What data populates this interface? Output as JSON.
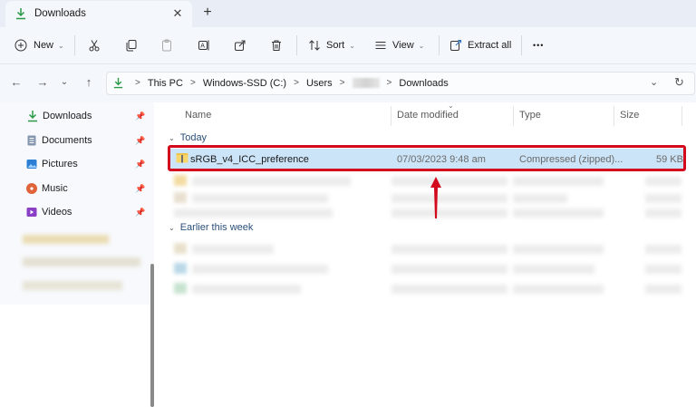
{
  "window": {
    "tab_title": "Downloads",
    "tab_close": "✕",
    "new_tab": "+"
  },
  "toolbar": {
    "new_label": "New",
    "sort_label": "Sort",
    "view_label": "View",
    "extract_label": "Extract all",
    "more_label": "•••"
  },
  "address": {
    "crumbs": [
      "This PC",
      "Windows-SSD (C:)",
      "Users",
      "Downloads"
    ],
    "separator": ">"
  },
  "sidebar": {
    "items": [
      {
        "label": "Downloads",
        "icon": "download-icon",
        "color": "#2b9a48"
      },
      {
        "label": "Documents",
        "icon": "documents-icon",
        "color": "#6b7a8f"
      },
      {
        "label": "Pictures",
        "icon": "pictures-icon",
        "color": "#2a7fd4"
      },
      {
        "label": "Music",
        "icon": "music-icon",
        "color": "#e0643a"
      },
      {
        "label": "Videos",
        "icon": "videos-icon",
        "color": "#8a3fc7"
      }
    ]
  },
  "columns": {
    "name": "Name",
    "date": "Date modified",
    "type": "Type",
    "size": "Size"
  },
  "groups": {
    "today": "Today",
    "earlier": "Earlier this week"
  },
  "selected_file": {
    "name": "sRGB_v4_ICC_preference",
    "date": "07/03/2023 9:48 am",
    "type": "Compressed (zipped)...",
    "size": "59 KB"
  },
  "colors": {
    "accent_highlight": "#d30a1d",
    "selection": "#cce4f7"
  }
}
